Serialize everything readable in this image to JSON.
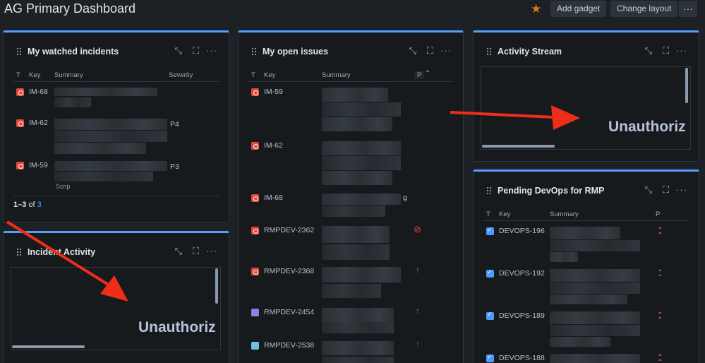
{
  "page": {
    "title": "AG Primary Dashboard",
    "star_icon": "star-icon",
    "add_gadget": "Add gadget",
    "change_layout": "Change layout",
    "more": "···"
  },
  "gadgets": {
    "watched": {
      "title": "My watched incidents",
      "headers": {
        "t": "T",
        "key": "Key",
        "summary": "Summary",
        "severity": "Severity"
      },
      "rows": [
        {
          "key": "IM-68",
          "severity": ""
        },
        {
          "key": "IM-62",
          "severity": "P4"
        },
        {
          "key": "IM-59",
          "severity": "P3"
        }
      ],
      "partial_text": "Scrip",
      "footer": {
        "range": "1–3",
        "of": "of",
        "total": "3"
      }
    },
    "incident_activity": {
      "title": "Incident Activity",
      "message": "Unauthoriz"
    },
    "open_issues": {
      "title": "My open issues",
      "headers": {
        "t": "T",
        "key": "Key",
        "summary": "Summary",
        "p": "P"
      },
      "rows": [
        {
          "key": "IM-59",
          "priority": ""
        },
        {
          "key": "IM-62",
          "priority": ""
        },
        {
          "key": "IM-68",
          "priority": "",
          "tail": "g"
        },
        {
          "key": "RMPDEV-2362",
          "priority": "blocker"
        },
        {
          "key": "RMPDEV-2368",
          "priority": "up"
        },
        {
          "key": "RMPDEV-2454",
          "priority": "up"
        },
        {
          "key": "RMPDEV-2538",
          "priority": "up"
        }
      ]
    },
    "activity_stream": {
      "title": "Activity Stream",
      "message": "Unauthoriz"
    },
    "devops": {
      "title": "Pending DevOps for RMP",
      "headers": {
        "t": "T",
        "key": "Key",
        "summary": "Summary",
        "p": "P"
      },
      "rows": [
        {
          "key": "DEVOPS-196"
        },
        {
          "key": "DEVOPS-192"
        },
        {
          "key": "DEVOPS-189"
        },
        {
          "key": "DEVOPS-188"
        }
      ]
    }
  },
  "colors": {
    "accent": "#579dff",
    "arrow": "#ee2d1a",
    "incident": "#e2483d"
  }
}
